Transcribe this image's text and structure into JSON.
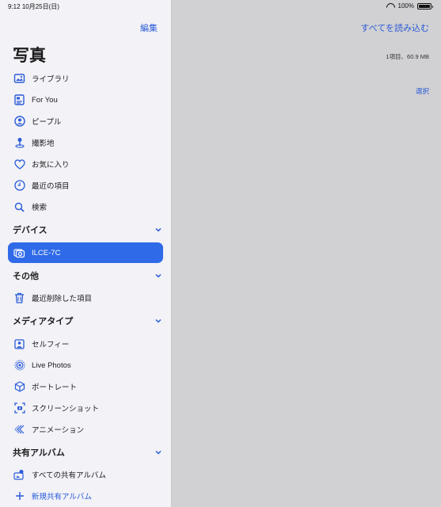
{
  "status_bar": {
    "time": "9:12",
    "date": "10月25日(日)",
    "battery": "100%"
  },
  "sidebar": {
    "edit_label": "編集",
    "title": "写真",
    "library_items": [
      {
        "label": "ライブラリ",
        "icon": "photo-library-icon"
      },
      {
        "label": "For You",
        "icon": "for-you-icon"
      },
      {
        "label": "ピープル",
        "icon": "people-icon"
      },
      {
        "label": "撮影地",
        "icon": "places-pin-icon"
      },
      {
        "label": "お気に入り",
        "icon": "heart-icon"
      },
      {
        "label": "最近の項目",
        "icon": "clock-icon"
      },
      {
        "label": "検索",
        "icon": "search-icon"
      }
    ],
    "devices": {
      "title": "デバイス",
      "items": [
        {
          "label": "ILCE-7C",
          "icon": "camera-import-icon",
          "selected": true
        }
      ]
    },
    "other": {
      "title": "その他",
      "items": [
        {
          "label": "最近削除した項目",
          "icon": "trash-icon"
        }
      ]
    },
    "media_types": {
      "title": "メディアタイプ",
      "items": [
        {
          "label": "セルフィー",
          "icon": "selfie-icon"
        },
        {
          "label": "Live Photos",
          "icon": "live-photos-icon"
        },
        {
          "label": "ポートレート",
          "icon": "portrait-cube-icon"
        },
        {
          "label": "スクリーンショット",
          "icon": "screenshot-icon"
        },
        {
          "label": "アニメーション",
          "icon": "animation-icon"
        }
      ]
    },
    "shared_albums": {
      "title": "共有アルバム",
      "items": [
        {
          "label": "すべての共有アルバム",
          "icon": "shared-albums-icon"
        },
        {
          "label": "新規共有アルバム",
          "icon": "plus-icon"
        }
      ]
    }
  },
  "main": {
    "import_all_label": "すべてを読み込む",
    "summary": "1項目、60.9 MB",
    "select_label": "選択"
  },
  "colors": {
    "accent": "#2a5bd7",
    "selected_bg": "#2f6ae8",
    "sidebar_bg": "#f2f2f7",
    "main_bg": "#d1d1d3"
  }
}
